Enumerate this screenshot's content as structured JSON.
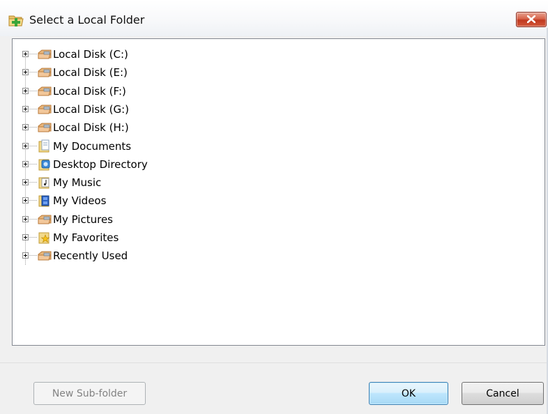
{
  "window": {
    "title": "Select a Local Folder",
    "title_icon": "folder-add-icon",
    "close_icon": "close-icon"
  },
  "tree": {
    "items": [
      {
        "label": "Local Disk (C:)",
        "icon": "drive-folder-icon"
      },
      {
        "label": "Local Disk (E:)",
        "icon": "drive-folder-icon"
      },
      {
        "label": "Local Disk (F:)",
        "icon": "drive-folder-icon"
      },
      {
        "label": "Local Disk (G:)",
        "icon": "drive-folder-icon"
      },
      {
        "label": "Local Disk (H:)",
        "icon": "drive-folder-icon"
      },
      {
        "label": "My Documents",
        "icon": "documents-folder-icon"
      },
      {
        "label": "Desktop Directory",
        "icon": "desktop-folder-icon"
      },
      {
        "label": "My Music",
        "icon": "music-folder-icon"
      },
      {
        "label": "My Videos",
        "icon": "videos-folder-icon"
      },
      {
        "label": "My Pictures",
        "icon": "pictures-folder-icon"
      },
      {
        "label": "My Favorites",
        "icon": "favorites-folder-icon"
      },
      {
        "label": "Recently Used",
        "icon": "recent-folder-icon"
      }
    ]
  },
  "buttons": {
    "new_subfolder": "New Sub-folder",
    "ok": "OK",
    "cancel": "Cancel"
  },
  "colors": {
    "close_button": "#c7452b",
    "default_button_border": "#3c7fb1"
  }
}
